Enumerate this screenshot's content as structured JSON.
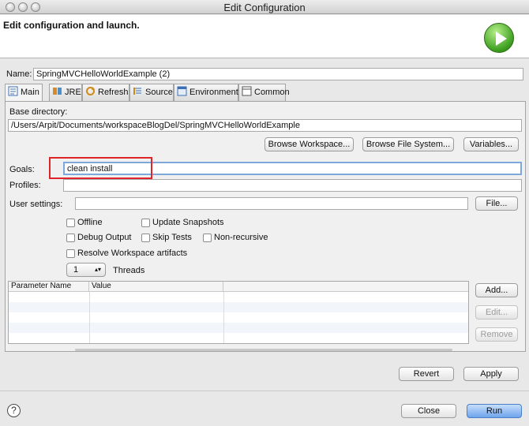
{
  "window": {
    "title": "Edit Configuration"
  },
  "header": {
    "title": "Edit configuration and launch.",
    "run_icon": "run-play-icon"
  },
  "name_field": {
    "label": "Name:",
    "value": "SpringMVCHelloWorldExample (2)"
  },
  "tabs": [
    {
      "label": "Main",
      "icon": "main-tab-icon"
    },
    {
      "label": "JRE",
      "icon": "jre-icon"
    },
    {
      "label": "Refresh",
      "icon": "refresh-icon"
    },
    {
      "label": "Source",
      "icon": "source-icon"
    },
    {
      "label": "Environment",
      "icon": "environment-icon"
    },
    {
      "label": "Common",
      "icon": "common-icon"
    }
  ],
  "main": {
    "base_dir_label": "Base directory:",
    "base_dir_value": "/Users/Arpit/Documents/workspaceBlogDel/SpringMVCHelloWorldExample",
    "browse_workspace": "Browse Workspace...",
    "browse_fs": "Browse File System...",
    "variables": "Variables...",
    "goals_label": "Goals:",
    "goals_value": "clean install",
    "profiles_label": "Profiles:",
    "profiles_value": "",
    "user_settings_label": "User settings:",
    "user_settings_value": "",
    "file_button": "File...",
    "options": {
      "offline": "Offline",
      "update_snapshots": "Update Snapshots",
      "debug_output": "Debug Output",
      "skip_tests": "Skip Tests",
      "non_recursive": "Non-recursive",
      "resolve_workspace": "Resolve Workspace artifacts"
    },
    "threads_value": "1",
    "threads_label": "Threads",
    "params_table": {
      "col_name": "Parameter Name",
      "col_value": "Value"
    },
    "add_button": "Add...",
    "edit_button": "Edit...",
    "remove_button": "Remove"
  },
  "footer": {
    "revert": "Revert",
    "apply": "Apply",
    "close": "Close",
    "run": "Run",
    "help": "?"
  },
  "colors": {
    "accent": "#6ea4ec",
    "highlight": "#e0242c",
    "run_green": "#3c9d1f"
  }
}
